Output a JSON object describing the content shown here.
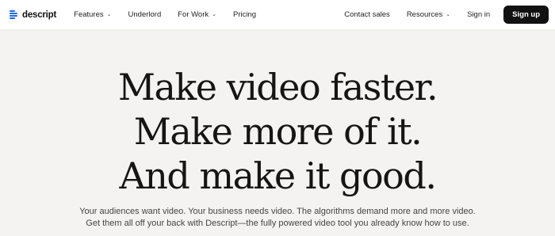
{
  "brand": {
    "name": "descript",
    "logo_icon": "descript-logo-icon",
    "accent": "#1e6ae0"
  },
  "nav": {
    "left": [
      {
        "label": "Features",
        "has_dropdown": true
      },
      {
        "label": "Underlord",
        "has_dropdown": false
      },
      {
        "label": "For Work",
        "has_dropdown": true
      },
      {
        "label": "Pricing",
        "has_dropdown": false
      }
    ],
    "right": {
      "contact_sales": "Contact sales",
      "resources": "Resources",
      "sign_in": "Sign in",
      "sign_up": "Sign up"
    },
    "dropdown_icon": "chevron-down-icon"
  },
  "hero": {
    "headline": [
      "Make video faster.",
      "Make more of it.",
      "And make it good."
    ],
    "subtext": [
      "Your audiences want video. Your business needs video. The algorithms demand more and more video.",
      "Get them all off your back with Descript—the fully powered video tool you already know how to use."
    ]
  },
  "colors": {
    "background": "#f4f3f1",
    "nav_background": "#ffffff",
    "button": "#111111",
    "button_text": "#ffffff"
  }
}
